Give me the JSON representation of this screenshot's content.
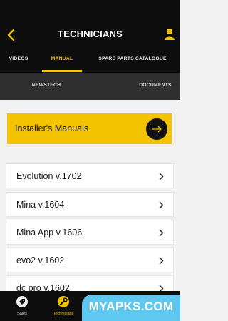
{
  "header": {
    "title": "TECHNICIANS",
    "back_icon": "chevron-left-icon",
    "user_icon": "user-icon",
    "accent_color": "#f3c300"
  },
  "tabs": [
    {
      "label": "VIDEOS",
      "active": false
    },
    {
      "label": "MANUAL",
      "active": true
    },
    {
      "label": "SPARE PARTS CATALOGUE",
      "active": false
    }
  ],
  "subtabs": [
    {
      "label": "NEWSTECH"
    },
    {
      "label": "DOCUMENTS"
    }
  ],
  "installer": {
    "label": "Installer's Manuals",
    "icon": "arrow-right-icon"
  },
  "manuals": [
    {
      "label": "Evolution v.1702"
    },
    {
      "label": "Mina v.1604"
    },
    {
      "label": "Mina App v.1606"
    },
    {
      "label": "evo2 v.1602"
    },
    {
      "label": "dc pro v.1602"
    }
  ],
  "bottom_nav": [
    {
      "label": "Sales",
      "icon": "tag-icon",
      "active": false
    },
    {
      "label": "Technicians",
      "icon": "wrench-icon",
      "active": true
    }
  ],
  "watermark": {
    "text": "MYAPKS.COM"
  }
}
